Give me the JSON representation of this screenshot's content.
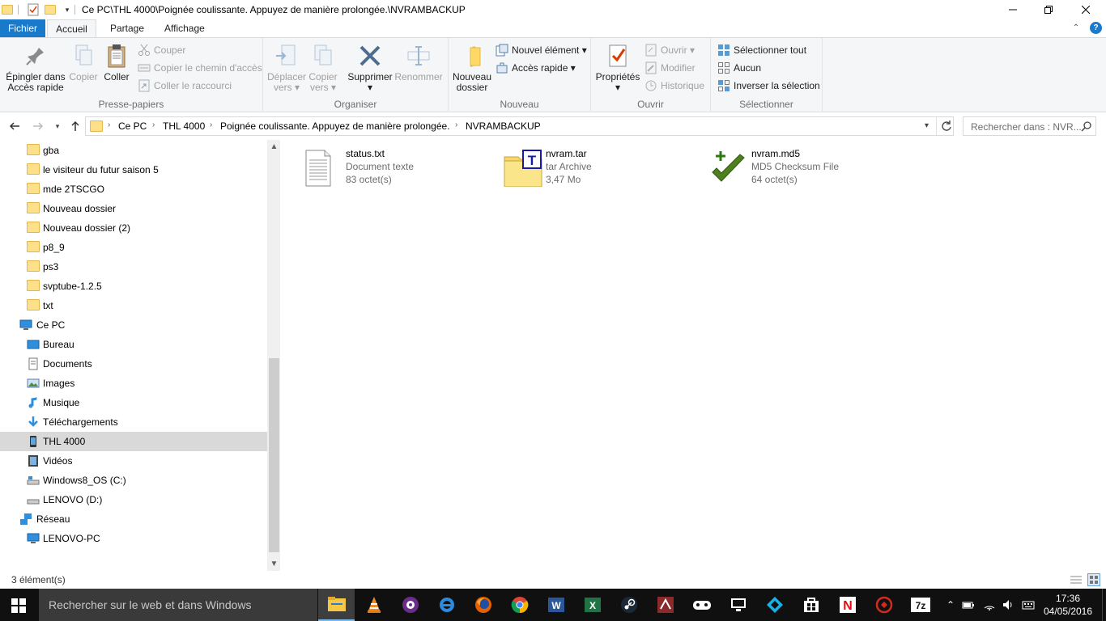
{
  "window": {
    "title": "Ce PC\\THL 4000\\Poignée coulissante. Appuyez de manière prolongée.\\NVRAMBACKUP"
  },
  "tabs": {
    "file": "Fichier",
    "home": "Accueil",
    "share": "Partage",
    "view": "Affichage"
  },
  "ribbon": {
    "clipboard": {
      "label": "Presse-papiers",
      "pin_line1": "Épingler dans",
      "pin_line2": "Accès rapide",
      "copy": "Copier",
      "paste": "Coller",
      "cut": "Couper",
      "copy_path": "Copier le chemin d'accès",
      "paste_shortcut": "Coller le raccourci"
    },
    "organize": {
      "label": "Organiser",
      "move_line1": "Déplacer",
      "move_line2": "vers",
      "copyto_line1": "Copier",
      "copyto_line2": "vers",
      "delete": "Supprimer",
      "rename": "Renommer"
    },
    "new": {
      "label": "Nouveau",
      "newfolder_line1": "Nouveau",
      "newfolder_line2": "dossier",
      "new_item": "Nouvel élément",
      "easy_access": "Accès rapide"
    },
    "open": {
      "label": "Ouvrir",
      "properties": "Propriétés",
      "open": "Ouvrir",
      "edit": "Modifier",
      "history": "Historique"
    },
    "select": {
      "label": "Sélectionner",
      "select_all": "Sélectionner tout",
      "select_none": "Aucun",
      "invert": "Inverser la sélection"
    }
  },
  "address": {
    "crumbs": [
      "Ce PC",
      "THL 4000",
      "Poignée coulissante. Appuyez de manière prolongée.",
      "NVRAMBACKUP"
    ],
    "search_placeholder": "Rechercher dans : NVR..."
  },
  "nav": {
    "folders": [
      "gba",
      "le visiteur du futur saison 5",
      "mde 2TSCGO",
      "Nouveau dossier",
      "Nouveau dossier (2)",
      "p8_9",
      "ps3",
      "svptube-1.2.5",
      "txt"
    ],
    "this_pc": "Ce PC",
    "pc_items": [
      "Bureau",
      "Documents",
      "Images",
      "Musique",
      "Téléchargements",
      "THL 4000",
      "Vidéos",
      "Windows8_OS (C:)",
      "LENOVO (D:)"
    ],
    "network": "Réseau",
    "network_items": [
      "LENOVO-PC"
    ]
  },
  "files": [
    {
      "name": "status.txt",
      "type": "Document texte",
      "size": "83 octet(s)",
      "icon": "text-file-icon"
    },
    {
      "name": "nvram.tar",
      "type": "tar Archive",
      "size": "3,47 Mo",
      "icon": "tar-archive-icon"
    },
    {
      "name": "nvram.md5",
      "type": "MD5 Checksum File",
      "size": "64 octet(s)",
      "icon": "md5-check-icon"
    }
  ],
  "status": {
    "count": "3 élément(s)"
  },
  "taskbar": {
    "search_placeholder": "Rechercher sur le web et dans Windows",
    "time": "17:36",
    "date": "04/05/2016"
  },
  "colors": {
    "file_tab": "#1979ca",
    "taskbar": "#101010",
    "selection": "#d9d9d9"
  }
}
